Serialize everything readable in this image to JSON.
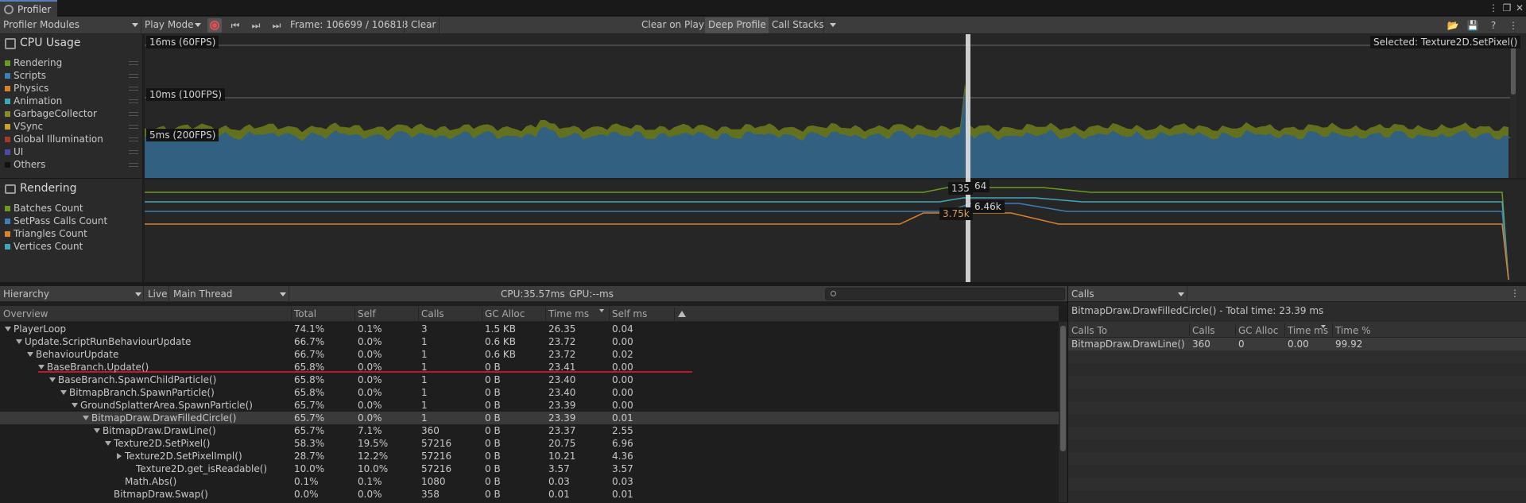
{
  "window": {
    "tab_title": "Profiler"
  },
  "toolbar": {
    "modules_dropdown": "Profiler Modules",
    "play_mode_dropdown": "Play Mode",
    "frame_label": "Frame: 106699 / 106818",
    "clear": "Clear",
    "clear_on_play": "Clear on Play",
    "deep_profile": "Deep Profile",
    "call_stacks": "Call Stacks"
  },
  "modules": {
    "cpu": {
      "title": "CPU Usage",
      "legend": [
        {
          "label": "Rendering",
          "color": "#6a9a1f"
        },
        {
          "label": "Scripts",
          "color": "#3c7fb8"
        },
        {
          "label": "Physics",
          "color": "#d9822b"
        },
        {
          "label": "Animation",
          "color": "#3fa7b5"
        },
        {
          "label": "GarbageCollector",
          "color": "#8a8a2a"
        },
        {
          "label": "VSync",
          "color": "#c9a227"
        },
        {
          "label": "Global Illumination",
          "color": "#a33a2a"
        },
        {
          "label": "UI",
          "color": "#4b4ba8"
        },
        {
          "label": "Others",
          "color": "#111111"
        }
      ],
      "fps_lines": [
        "16ms (60FPS)",
        "10ms (100FPS)",
        "5ms (200FPS)"
      ],
      "selected": "Selected: Texture2D.SetPixel()"
    },
    "rendering": {
      "title": "Rendering",
      "legend": [
        {
          "label": "Batches Count",
          "color": "#6a9a1f"
        },
        {
          "label": "SetPass Calls Count",
          "color": "#3c7fb8"
        },
        {
          "label": "Triangles Count",
          "color": "#d9822b"
        },
        {
          "label": "Vertices Count",
          "color": "#3fa7b5"
        }
      ],
      "badges": {
        "batches": "135",
        "setpass": "64",
        "triangles": "3.75k",
        "vertices": "6.46k"
      }
    }
  },
  "hierarchy": {
    "view_dropdown": "Hierarchy",
    "live": "Live",
    "thread_dropdown": "Main Thread",
    "cpu_time": "CPU:35.57ms",
    "gpu_time": "GPU:--ms",
    "search_placeholder": "",
    "columns": [
      "Overview",
      "Total",
      "Self",
      "Calls",
      "GC Alloc",
      "Time ms",
      "Self ms"
    ],
    "rows": [
      {
        "name": "PlayerLoop",
        "total": "74.1%",
        "self": "0.1%",
        "calls": "3",
        "gc": "1.5 KB",
        "time": "26.35",
        "selfms": "0.04"
      },
      {
        "name": "Update.ScriptRunBehaviourUpdate",
        "total": "66.7%",
        "self": "0.0%",
        "calls": "1",
        "gc": "0.6 KB",
        "time": "23.72",
        "selfms": "0.00"
      },
      {
        "name": "BehaviourUpdate",
        "total": "66.7%",
        "self": "0.0%",
        "calls": "1",
        "gc": "0.6 KB",
        "time": "23.72",
        "selfms": "0.02"
      },
      {
        "name": "BaseBranch.Update()",
        "total": "65.8%",
        "self": "0.0%",
        "calls": "1",
        "gc": "0 B",
        "time": "23.41",
        "selfms": "0.00"
      },
      {
        "name": "BaseBranch.SpawnChildParticle()",
        "total": "65.8%",
        "self": "0.0%",
        "calls": "1",
        "gc": "0 B",
        "time": "23.40",
        "selfms": "0.00"
      },
      {
        "name": "BitmapBranch.SpawnParticle()",
        "total": "65.8%",
        "self": "0.0%",
        "calls": "1",
        "gc": "0 B",
        "time": "23.40",
        "selfms": "0.00"
      },
      {
        "name": "GroundSplatterArea.SpawnParticle()",
        "total": "65.7%",
        "self": "0.0%",
        "calls": "1",
        "gc": "0 B",
        "time": "23.39",
        "selfms": "0.00"
      },
      {
        "name": "BitmapDraw.DrawFilledCircle()",
        "total": "65.7%",
        "self": "0.0%",
        "calls": "1",
        "gc": "0 B",
        "time": "23.39",
        "selfms": "0.01"
      },
      {
        "name": "BitmapDraw.DrawLine()",
        "total": "65.7%",
        "self": "7.1%",
        "calls": "360",
        "gc": "0 B",
        "time": "23.37",
        "selfms": "2.55"
      },
      {
        "name": "Texture2D.SetPixel()",
        "total": "58.3%",
        "self": "19.5%",
        "calls": "57216",
        "gc": "0 B",
        "time": "20.75",
        "selfms": "6.96"
      },
      {
        "name": "Texture2D.SetPixelImpl()",
        "total": "28.7%",
        "self": "12.2%",
        "calls": "57216",
        "gc": "0 B",
        "time": "10.21",
        "selfms": "4.36"
      },
      {
        "name": "Texture2D.get_isReadable()",
        "total": "10.0%",
        "self": "10.0%",
        "calls": "57216",
        "gc": "0 B",
        "time": "3.57",
        "selfms": "3.57"
      },
      {
        "name": "Math.Abs()",
        "total": "0.1%",
        "self": "0.1%",
        "calls": "1080",
        "gc": "0 B",
        "time": "0.03",
        "selfms": "0.03"
      },
      {
        "name": "BitmapDraw.Swap()",
        "total": "0.0%",
        "self": "0.0%",
        "calls": "358",
        "gc": "0 B",
        "time": "0.01",
        "selfms": "0.01"
      }
    ]
  },
  "calls": {
    "dropdown": "Calls",
    "summary": "BitmapDraw.DrawFilledCircle() - Total time: 23.39 ms",
    "columns": [
      "Calls To",
      "Calls",
      "GC Alloc",
      "Time ms",
      "Time %"
    ],
    "rows": [
      {
        "name": "BitmapDraw.DrawLine()",
        "calls": "360",
        "gc": "0",
        "time": "0.00",
        "pct": "99.92"
      }
    ]
  }
}
